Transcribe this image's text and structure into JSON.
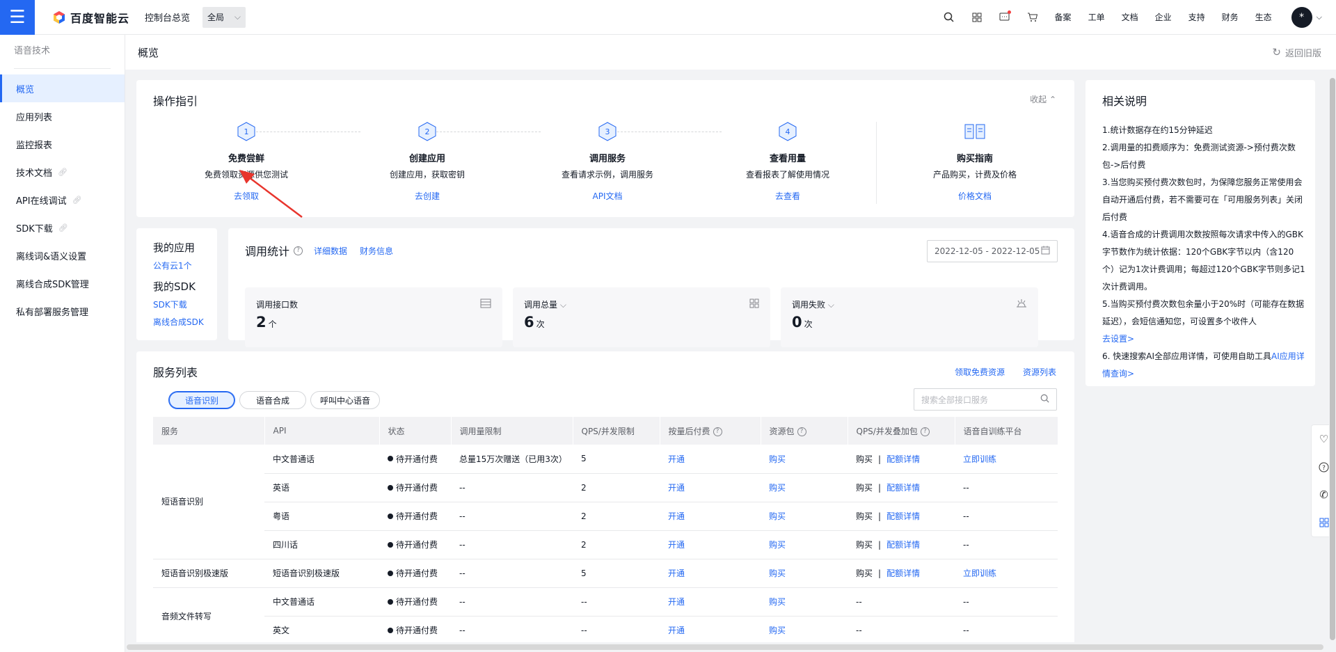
{
  "topbar": {
    "logo_text": "百度智能云",
    "console_label": "控制台总览",
    "region_label": "全局",
    "links": [
      "备案",
      "工单",
      "文档",
      "企业",
      "支持",
      "财务",
      "生态"
    ],
    "avatar_text": "*"
  },
  "sidebar": {
    "title": "语音技术",
    "items": [
      {
        "label": "概览"
      },
      {
        "label": "应用列表"
      },
      {
        "label": "监控报表"
      },
      {
        "label": "技术文档"
      },
      {
        "label": "API在线调试"
      },
      {
        "label": "SDK下载"
      },
      {
        "label": "离线词&语义设置"
      },
      {
        "label": "离线合成SDK管理"
      },
      {
        "label": "私有部署服务管理"
      }
    ]
  },
  "page": {
    "title": "概览",
    "back_old": "返回旧版"
  },
  "guide": {
    "title": "操作指引",
    "collapse": "收起",
    "steps": [
      {
        "num": "1",
        "name": "免费尝鲜",
        "desc": "免费领取资源供您测试",
        "link": "去领取"
      },
      {
        "num": "2",
        "name": "创建应用",
        "desc": "创建应用，获取密钥",
        "link": "去创建"
      },
      {
        "num": "3",
        "name": "调用服务",
        "desc": "查看请求示例，调用服务",
        "link": "API文档"
      },
      {
        "num": "4",
        "name": "查看用量",
        "desc": "查看报表了解使用情况",
        "link": "去查看"
      }
    ],
    "buy": {
      "name": "购买指南",
      "desc": "产品购买，计费及价格",
      "link": "价格文档"
    }
  },
  "myapps": {
    "apps_title": "我的应用",
    "apps_link": "公有云1个",
    "sdk_title": "我的SDK",
    "sdk_links": [
      "SDK下载",
      "离线合成SDK"
    ]
  },
  "stats": {
    "title": "调用统计",
    "links": [
      "详细数据",
      "财务信息"
    ],
    "date_range": "2022-12-05 - 2022-12-05",
    "boxes": [
      {
        "label": "调用接口数",
        "value": "2",
        "unit": "个",
        "icon": "table-icon"
      },
      {
        "label": "调用总量",
        "value": "6",
        "unit": "次",
        "icon": "grid-icon"
      },
      {
        "label": "调用失败",
        "value": "0",
        "unit": "次",
        "icon": "fail-icon"
      }
    ]
  },
  "services": {
    "title": "服务列表",
    "links": [
      "领取免费资源",
      "资源列表"
    ],
    "tabs": [
      "语音识别",
      "语音合成",
      "呼叫中心语音"
    ],
    "search_placeholder": "搜索全部接口服务",
    "columns": [
      "服务",
      "API",
      "状态",
      "调用量限制",
      "QPS/并发限制",
      "按量后付费",
      "资源包",
      "QPS/并发叠加包",
      "语音自训练平台"
    ],
    "groups": [
      {
        "service": "短语音识别",
        "rows": [
          {
            "api": "中文普通话",
            "status": "待开通付费",
            "limit": "总量15万次赠送（已用3次）",
            "qps": "5",
            "postpay": "开通",
            "pkg": "购买",
            "qps_buy": "购买",
            "qps_detail": "配额详情",
            "train": "立即训练"
          },
          {
            "api": "英语",
            "status": "待开通付费",
            "limit": "--",
            "qps": "2",
            "postpay": "开通",
            "pkg": "购买",
            "qps_buy": "购买",
            "qps_detail": "配额详情",
            "train": "--"
          },
          {
            "api": "粤语",
            "status": "待开通付费",
            "limit": "--",
            "qps": "2",
            "postpay": "开通",
            "pkg": "购买",
            "qps_buy": "购买",
            "qps_detail": "配额详情",
            "train": "--"
          },
          {
            "api": "四川话",
            "status": "待开通付费",
            "limit": "--",
            "qps": "2",
            "postpay": "开通",
            "pkg": "购买",
            "qps_buy": "购买",
            "qps_detail": "配额详情",
            "train": "--"
          }
        ]
      },
      {
        "service": "短语音识别极速版",
        "rows": [
          {
            "api": "短语音识别极速版",
            "status": "待开通付费",
            "limit": "--",
            "qps": "5",
            "postpay": "开通",
            "pkg": "购买",
            "qps_buy": "购买",
            "qps_detail": "配额详情",
            "train": "立即训练"
          }
        ]
      },
      {
        "service": "音频文件转写",
        "rows": [
          {
            "api": "中文普通话",
            "status": "待开通付费",
            "limit": "--",
            "qps": "--",
            "postpay": "开通",
            "pkg": "购买",
            "qps_buy": "--",
            "qps_detail": "",
            "train": "--"
          },
          {
            "api": "英文",
            "status": "待开通付费",
            "limit": "--",
            "qps": "--",
            "postpay": "开通",
            "pkg": "购买",
            "qps_buy": "--",
            "qps_detail": "",
            "train": "--"
          }
        ]
      }
    ]
  },
  "notes": {
    "title": "相关说明",
    "items": [
      "1.统计数据存在约15分钟延迟",
      "2.调用量的扣费顺序为：免费测试资源->预付费次数包->后付费",
      "3.当您购买预付费次数包时，为保障您服务正常使用会自动开通后付费，若不需要可在「可用服务列表」关闭后付费",
      "4.语音合成的计费调用次数按照每次请求中传入的GBK字节数作为统计依据：120个GBK字节以内（含120个）记为1次计费调用；每超过120个GBK字节则多记1次计费调用。",
      "5.当购买预付费次数包余量小于20%时（可能存在数据延迟），会短信通知您，可设置多个收件人"
    ],
    "set_link": "去设置>",
    "item6_prefix": "6. 快速搜索AI全部应用详情，可使用自助工具",
    "item6_link": "AI应用详情查询>"
  },
  "colors": {
    "accent": "#2468f2",
    "annotation_arrow": "#e8352d"
  }
}
